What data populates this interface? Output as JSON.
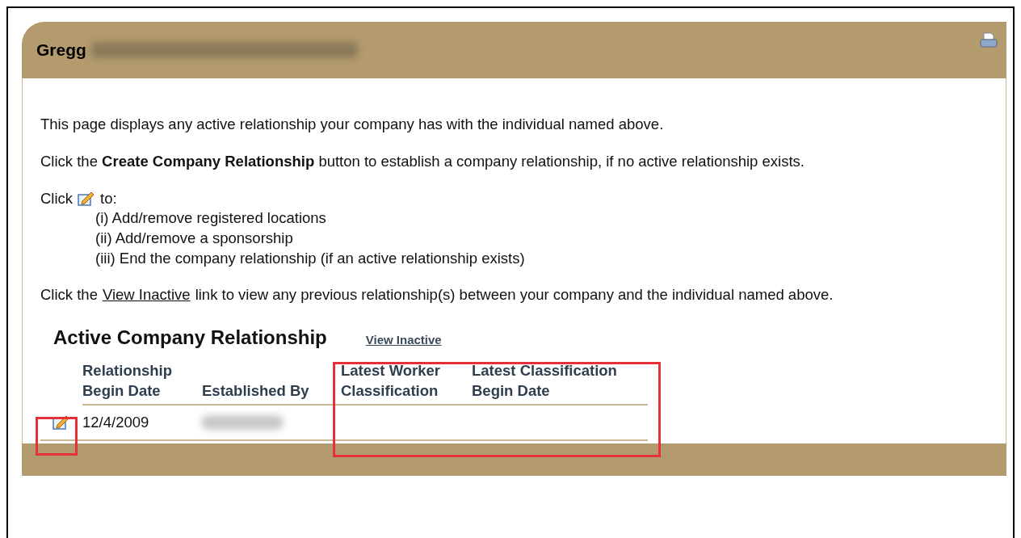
{
  "header": {
    "title": "Gregg"
  },
  "intro": [
    "This page displays any active relationship your company has with the individual named above.",
    "Click the **Create Company Relationship** button to establish a company relationship, if no active relationship exists."
  ],
  "edit_help": {
    "before": "Click",
    "after": "to:",
    "items": [
      "(i) Add/remove registered locations",
      "(ii) Add/remove a sponsorship",
      "(iii) End the company relationship (if an active relationship exists)"
    ]
  },
  "inactive_help": {
    "before": "Click the",
    "link": "View Inactive",
    "after": "link to view any previous relationship(s) between your company and the individual named above."
  },
  "section": {
    "title": "Active Company Relationship",
    "link": "View Inactive"
  },
  "table": {
    "columns": [
      {
        "label": "Relationship Begin Date"
      },
      {
        "label": "Established By"
      },
      {
        "label": "Latest Worker Classification"
      },
      {
        "label": "Latest Classification Begin Date"
      }
    ],
    "rows": [
      {
        "cells": [
          "12/4/2009",
          "",
          "",
          ""
        ]
      }
    ]
  }
}
